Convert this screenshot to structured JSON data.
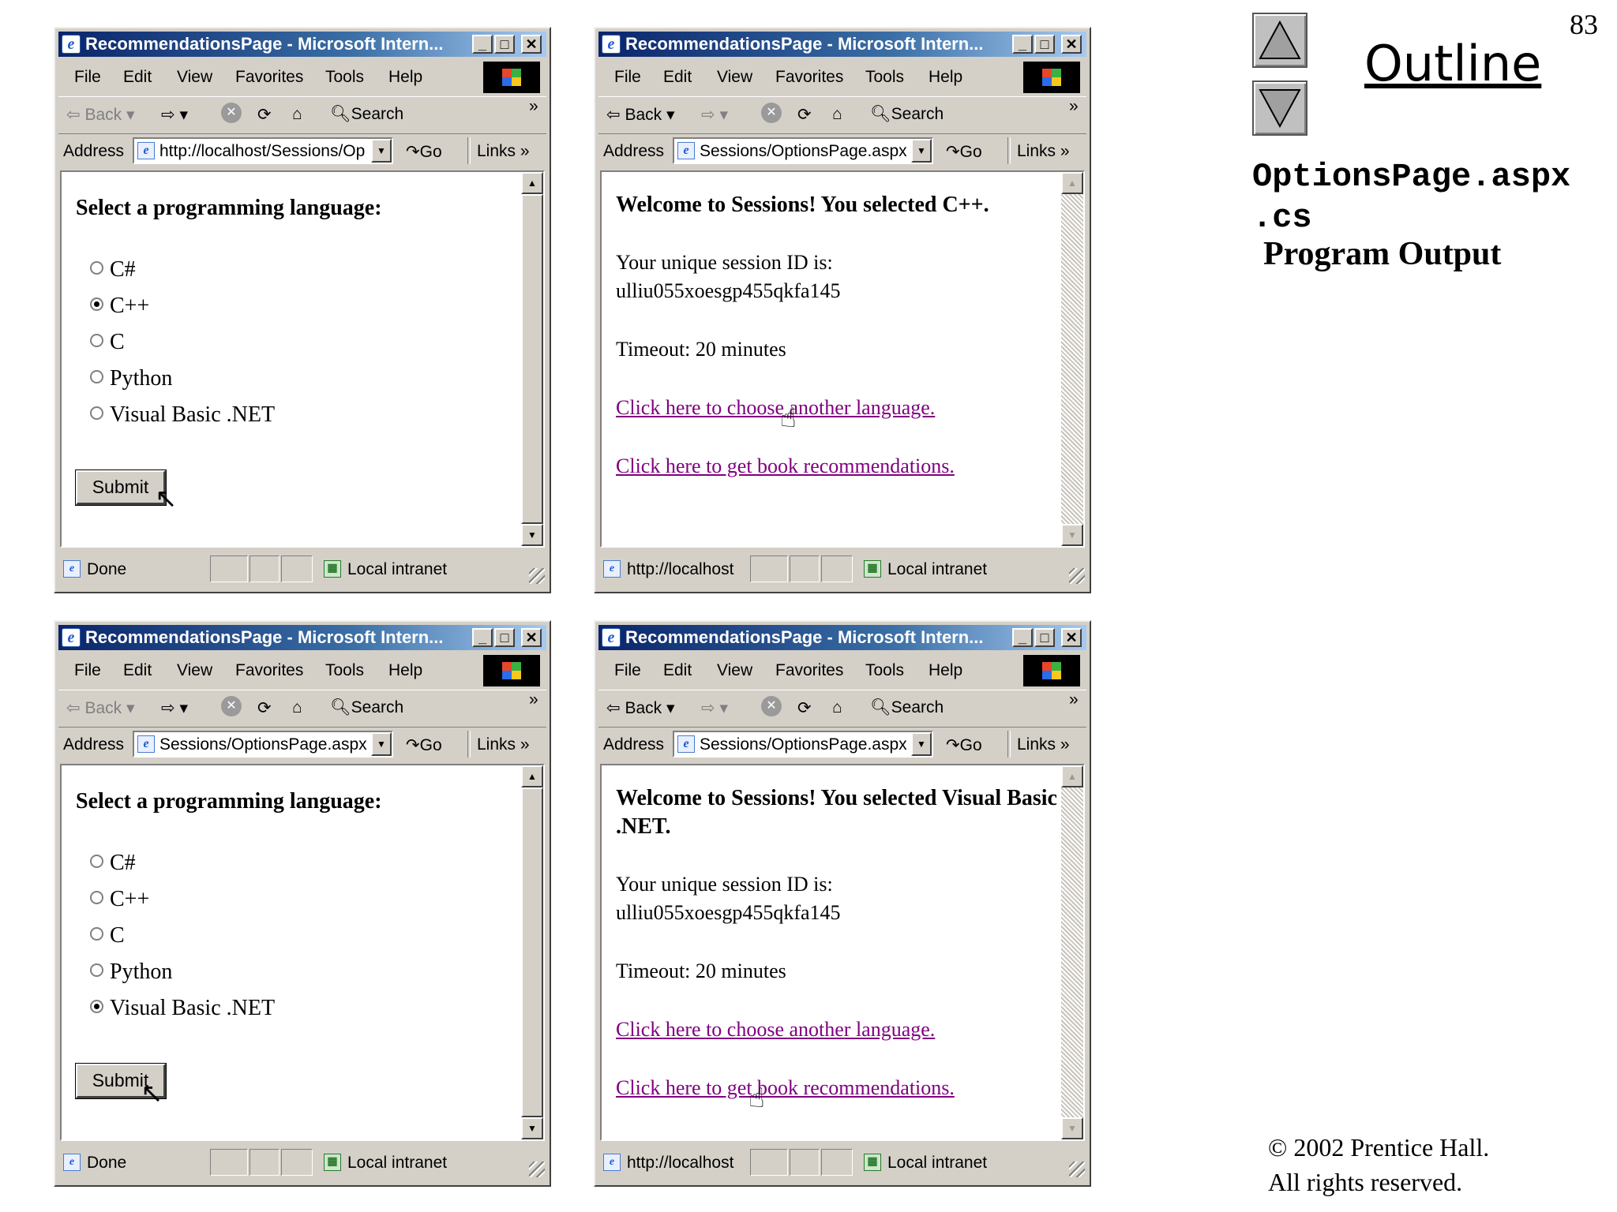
{
  "slide": {
    "page_number": "83",
    "outline_label": "Outline",
    "file_line1": "OptionsPage.aspx",
    "file_line2": ".cs",
    "subtitle": "Program Output",
    "copyright_line1": "© 2002 Prentice Hall.",
    "copyright_line2": "All rights reserved."
  },
  "browser": {
    "title": "RecommendationsPage - Microsoft Intern...",
    "menu": [
      "File",
      "Edit",
      "View",
      "Favorites",
      "Tools",
      "Help"
    ],
    "back": "Back",
    "search": "Search",
    "address_label": "Address",
    "go": "Go",
    "links": "Links",
    "status_intranet": "Local intranet"
  },
  "windows": [
    {
      "address": "http://localhost/Sessions/Op",
      "status": "Done",
      "form": {
        "heading": "Select a programming language:",
        "options": [
          "C#",
          "C++",
          "C",
          "Python",
          "Visual Basic .NET"
        ],
        "selected": 1,
        "submit": "Submit"
      }
    },
    {
      "address": "Sessions/OptionsPage.aspx",
      "status": "http://localhost",
      "result": {
        "welcome": "Welcome to Sessions! You selected C++.",
        "session_label": "Your unique session ID is:",
        "session_id": "ulliu055xoesgp455qkfa145",
        "timeout": "Timeout: 20 minutes",
        "link_language": "Click here to choose another language.",
        "link_books": "Click here to get book recommendations."
      }
    },
    {
      "address": "Sessions/OptionsPage.aspx",
      "status": "Done",
      "form": {
        "heading": "Select a programming language:",
        "options": [
          "C#",
          "C++",
          "C",
          "Python",
          "Visual Basic .NET"
        ],
        "selected": 4,
        "submit": "Submit"
      }
    },
    {
      "address": "Sessions/OptionsPage.aspx",
      "status": "http://localhost",
      "result": {
        "welcome": "Welcome to Sessions! You selected Visual Basic .NET.",
        "session_label": "Your unique session ID is:",
        "session_id": "ulliu055xoesgp455qkfa145",
        "timeout": "Timeout: 20 minutes",
        "link_language": "Click here to choose another language.",
        "link_books": "Click here to get book recommendations."
      }
    }
  ]
}
